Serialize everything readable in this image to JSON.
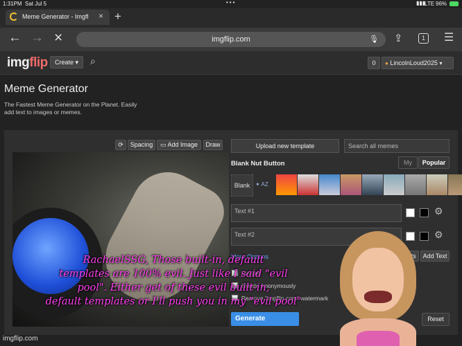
{
  "status_bar": {
    "time": "1:31PM",
    "date": "Sat Jul 5",
    "network": "LTE",
    "battery": "96%"
  },
  "browser": {
    "tab_title": "Meme Generator - Imgfl",
    "url": "imgflip.com",
    "tab_count": "1"
  },
  "site": {
    "logo_img": "img",
    "logo_flip": "flip",
    "create_label": "Create",
    "notif_count": "0",
    "username": "LincolnLoud2025"
  },
  "header": {
    "title": "Meme Generator",
    "subtitle_line1": "The Fastest Meme Generator on the Planet. Easily",
    "subtitle_line2": "add text to images or memes."
  },
  "editor_toolbar": {
    "spacing": "Spacing",
    "add_image": "Add Image",
    "draw": "Draw"
  },
  "sidebar": {
    "upload_label": "Upload new template",
    "search_placeholder": "Search all memes",
    "template_name": "Blank Nut Button",
    "tab_my": "My",
    "tab_popular": "Popular",
    "blank_label": "Blank",
    "az_label": "AZ",
    "text1_placeholder": "Text #1",
    "text2_placeholder": "Text #2",
    "more_options": "More Options",
    "private_label": "Private",
    "anon_label": "Create Anonymously",
    "watermark_label": "Remove \"imgflip.com\" watermark",
    "effects_label": "Effects",
    "add_text_label": "Add Text",
    "generate_label": "Generate",
    "reset_label": "Reset"
  },
  "footer_watermark": "imgflip.com",
  "overlay_caption": [
    "RachaelSSG, Those built-in, default",
    "templates are 100% evil. Just like I said \"evil",
    "pool\". Either get of these evil built-in,",
    "default templates or I'll push you in my \"evil pool\""
  ],
  "colors": {
    "accent": "#4a90e2",
    "caption": "#ff3df0",
    "button": "#3a8ee6"
  }
}
